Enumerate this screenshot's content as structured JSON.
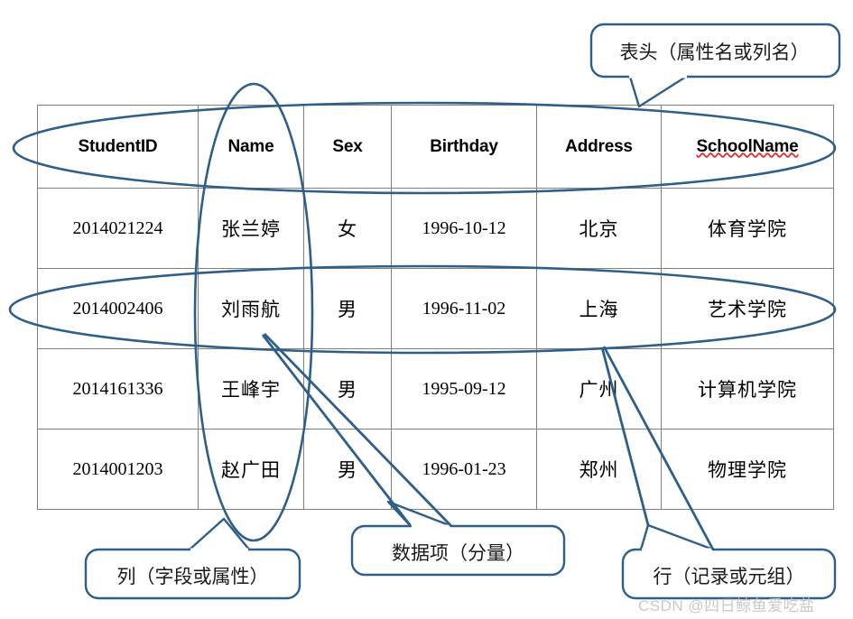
{
  "table": {
    "headers": [
      "StudentID",
      "Name",
      "Sex",
      "Birthday",
      "Address",
      "SchoolName"
    ],
    "misspelled_header": "SchoolName",
    "rows": [
      {
        "StudentID": "2014021224",
        "Name": "张兰婷",
        "Sex": "女",
        "Birthday": "1996-10-12",
        "Address": "北京",
        "SchoolName": "体育学院"
      },
      {
        "StudentID": "2014002406",
        "Name": "刘雨航",
        "Sex": "男",
        "Birthday": "1996-11-02",
        "Address": "上海",
        "SchoolName": "艺术学院"
      },
      {
        "StudentID": "2014161336",
        "Name": "王峰宇",
        "Sex": "男",
        "Birthday": "1995-09-12",
        "Address": "广州",
        "SchoolName": "计算机学院"
      },
      {
        "StudentID": "2014001203",
        "Name": "赵广田",
        "Sex": "男",
        "Birthday": "1996-01-23",
        "Address": "郑州",
        "SchoolName": "物理学院"
      }
    ]
  },
  "annotations": {
    "header_callout": "表头（属性名或列名）",
    "column_callout": "列（字段或属性）",
    "item_callout": "数据项（分量）",
    "row_callout": "行（记录或元组）"
  },
  "colors": {
    "annotation_blue": "#2e5f8a",
    "table_border": "#808080",
    "misspell_red": "#e03030",
    "watermark_gray": "#c9c9c9"
  },
  "watermark": "CSDN @四日鲸鱼爱吃盐"
}
